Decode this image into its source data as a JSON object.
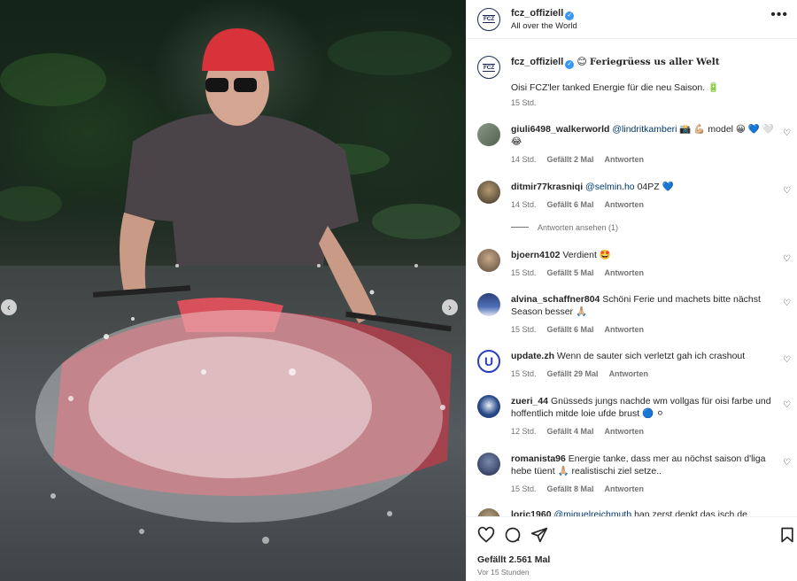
{
  "account": {
    "username": "fcz_offiziell",
    "location": "All over the World",
    "logo_text": "FCZ"
  },
  "caption": {
    "username": "fcz_offiziell",
    "title": "Feriegrüess us aller Welt",
    "emoji_title": "😊",
    "text": "Oisi FCZ'ler tanked Energie für die neu Saison.",
    "emoji_text": "🔋",
    "time": "15 Std."
  },
  "comments": [
    {
      "user": "giuli6498_walkerworld",
      "mention": "@lindritkamberi",
      "text": " 📸 💪🏼 model 😀 💙 🤍",
      "text2": "😂",
      "time": "14 Std.",
      "likes": "Gefällt 2 Mal",
      "reply": "Antworten"
    },
    {
      "user": "ditmir77krasniqi",
      "mention": "@selmin.ho",
      "text": " 04PZ 💙",
      "time": "14 Std.",
      "likes": "Gefällt 6 Mal",
      "reply": "Antworten"
    },
    {
      "user": "bjoern4102",
      "mention": "",
      "text": "Verdient 🤩",
      "time": "15 Std.",
      "likes": "Gefällt 5 Mal",
      "reply": "Antworten"
    },
    {
      "user": "alvina_schaffner804",
      "mention": "",
      "text": "Schöni Ferie und machets bitte nächst",
      "text2": "Season besser 🙏🏼",
      "time": "15 Std.",
      "likes": "Gefällt 6 Mal",
      "reply": "Antworten"
    },
    {
      "user": "update.zh",
      "mention": "",
      "text": "Wenn de sauter sich verletzt gah ich crashout",
      "time": "15 Std.",
      "likes": "Gefällt 29 Mal",
      "reply": "Antworten"
    },
    {
      "user": "zueri_44",
      "mention": "",
      "text": "Gnüsseds jungs nachde wm vollgas für oisi farbe und",
      "text2": "hoffentlich mitde loie ufde brust 🔵 ⚪",
      "time": "12 Std.",
      "likes": "Gefällt 4 Mal",
      "reply": "Antworten"
    },
    {
      "user": "romanista96",
      "mention": "",
      "text": "Energie tanke, dass mer au nöchst saison d'liga",
      "text2": "hebe tüent 🙏🏼 realistischi ziel setze..",
      "time": "15 Std.",
      "likes": "Gefällt 8 Mal",
      "reply": "Antworten"
    },
    {
      "user": "loric1960",
      "mention": "@miguelreichmuth",
      "text": " han zerst denkt das isch de",
      "time": "",
      "likes": "",
      "reply": ""
    }
  ],
  "view_replies": "Antworten ansehen (1)",
  "footer": {
    "likes": "Gefällt 2.561 Mal",
    "time": "Vor 15 Stunden"
  },
  "colors": {
    "verified": "#3897f0",
    "mention": "#00376b",
    "muted": "#737373",
    "fcz_navy": "#1c2a54"
  }
}
